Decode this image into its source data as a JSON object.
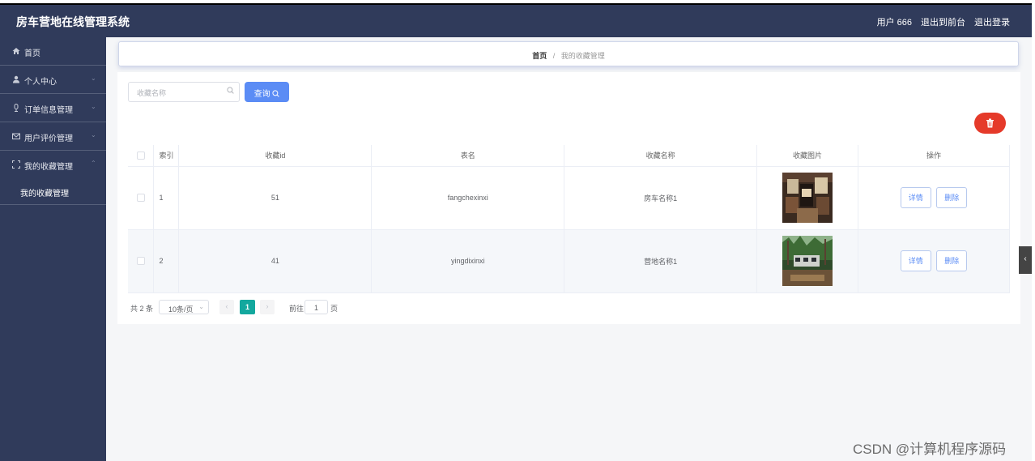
{
  "header": {
    "title": "房车营地在线管理系统",
    "user": "用户 666",
    "front": "退出到前台",
    "logout": "退出登录"
  },
  "sidebar": {
    "items": [
      {
        "label": "首页",
        "icon": "home-icon"
      },
      {
        "label": "个人中心",
        "icon": "user-icon"
      },
      {
        "label": "订单信息管理",
        "icon": "microphone-icon"
      },
      {
        "label": "用户评价管理",
        "icon": "mail-icon"
      },
      {
        "label": "我的收藏管理",
        "icon": "expand-icon"
      }
    ],
    "subitems": [
      {
        "label": "我的收藏管理"
      }
    ]
  },
  "breadcrumb": {
    "home": "首页",
    "separator": "/",
    "current": "我的收藏管理"
  },
  "search": {
    "placeholder": "收藏名称",
    "button": "查询"
  },
  "table": {
    "headers": [
      "",
      "索引",
      "收藏id",
      "表名",
      "收藏名称",
      "收藏图片",
      "操作"
    ],
    "rows": [
      {
        "index": "1",
        "id": "51",
        "table": "fangchexinxi",
        "name": "房车名称1",
        "image": "rv-interior-photo"
      },
      {
        "index": "2",
        "id": "41",
        "table": "yingdixinxi",
        "name": "营地名称1",
        "image": "camp-forest-photo"
      }
    ],
    "detail_label": "详情",
    "delete_label": "删除"
  },
  "pagination": {
    "total": "共 2 条",
    "page_size": "10条/页",
    "current_page": "1",
    "goto_label": "前往",
    "goto_value": "1",
    "page_unit": "页"
  },
  "watermark": "CSDN @计算机程序源码",
  "colors": {
    "header_bg": "#303b5b",
    "primary": "#5b8cf5",
    "danger": "#e53a2a",
    "page_active": "#13a89e"
  }
}
